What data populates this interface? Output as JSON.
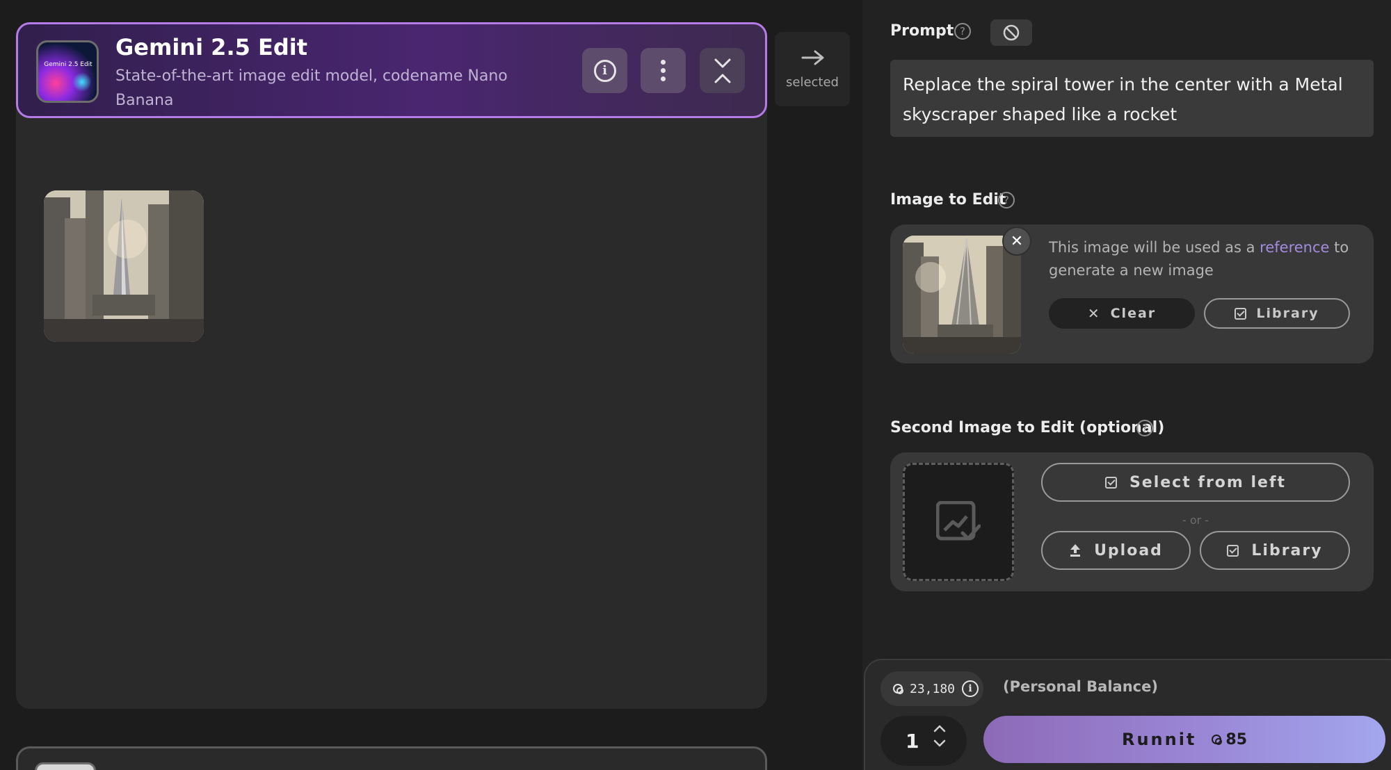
{
  "node": {
    "title": "Gemini 2.5 Edit",
    "description": "State-of-the-art image edit model, codename Nano Banana",
    "thumb_text": "Gemini 2.5 Edit"
  },
  "selected": {
    "label": "selected"
  },
  "prompt": {
    "label": "Prompt",
    "value": "Replace the spiral tower in the center with a Metal skyscraper shaped like a rocket"
  },
  "image_to_edit": {
    "label": "Image to Edit",
    "text_before": "This image will be used as a ",
    "link_text": "reference",
    "text_after": " to generate a new image",
    "clear_label": "Clear",
    "library_label": "Library"
  },
  "second_image": {
    "label": "Second Image to Edit (optional)",
    "select_label": "Select from left",
    "or_text": "- or -",
    "upload_label": "Upload",
    "library_label": "Library"
  },
  "run": {
    "balance": "23,180",
    "balance_label": "(Personal Balance)",
    "quantity": "1",
    "button_label": "Runnit",
    "cost": "85"
  },
  "colors": {
    "accent": "#b57be6",
    "run_gradient_start": "#8d6ab8",
    "run_gradient_end": "#a3a6ee",
    "link": "#a38ce0"
  }
}
